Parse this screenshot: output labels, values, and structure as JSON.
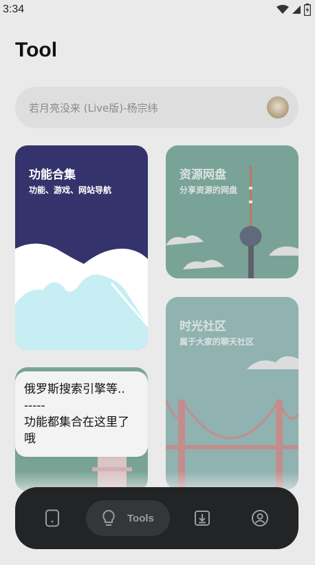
{
  "status_bar": {
    "time": "3:34"
  },
  "header": {
    "title": "Tool"
  },
  "search": {
    "text": "若月亮没来 (Live版)-杨宗纬"
  },
  "cards": [
    {
      "title": "功能合集",
      "subtitle": "功能、游戏、网站导航"
    },
    {
      "title": "资源网盘",
      "subtitle": "分享资源的网盘"
    },
    {
      "title": "时光社区",
      "subtitle": "属于大家的聊天社区"
    }
  ],
  "tooltip": {
    "lines": [
      "俄罗斯搜索引擎等..",
      "-----",
      "功能都集合在这里了",
      "哦"
    ]
  },
  "nav": {
    "active_label": "Tools"
  },
  "colors": {
    "card_navy": "#34336b",
    "card_green": "#4f8a78",
    "card_teal": "#6f9e9c",
    "nav_bg": "#222426"
  }
}
